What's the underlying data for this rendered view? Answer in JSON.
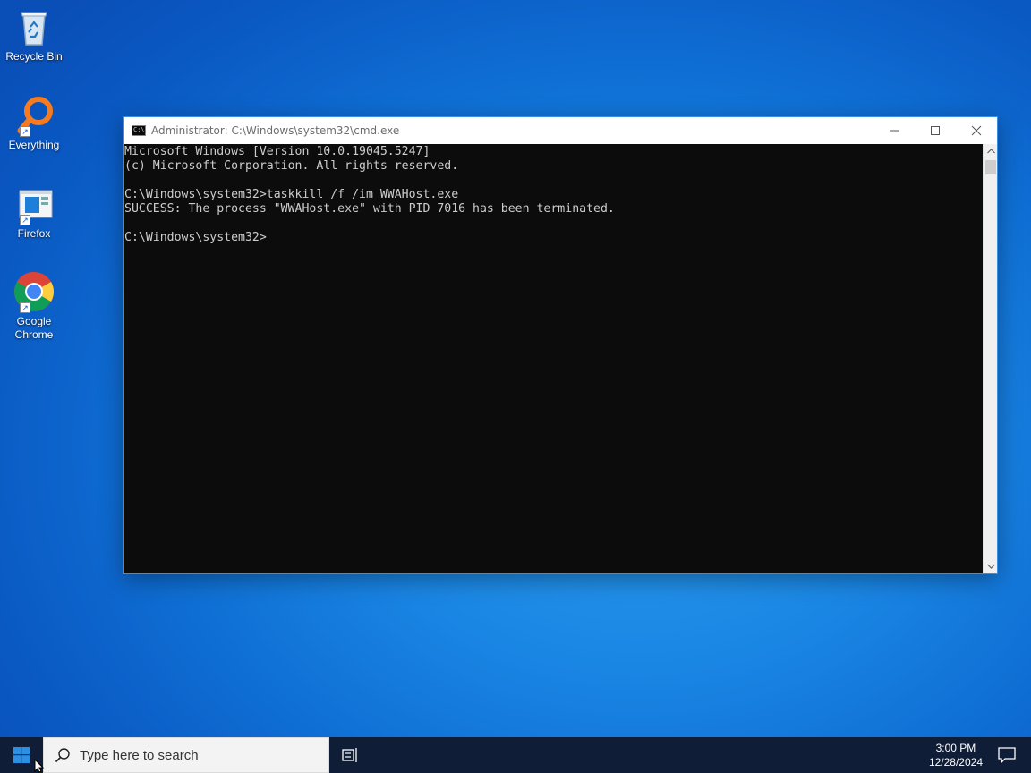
{
  "desktop": {
    "icons": [
      {
        "label": "Recycle Bin",
        "icon": "recycle-bin-icon"
      },
      {
        "label": "Everything",
        "icon": "everything-search-icon"
      },
      {
        "label": "Firefox",
        "icon": "firefox-icon"
      },
      {
        "label": "Google Chrome",
        "icon": "chrome-icon"
      }
    ]
  },
  "cmd": {
    "title": "Administrator: C:\\Windows\\system32\\cmd.exe",
    "lines": [
      "Microsoft Windows [Version 10.0.19045.5247]",
      "(c) Microsoft Corporation. All rights reserved.",
      "",
      "C:\\Windows\\system32>taskkill /f /im WWAHost.exe",
      "SUCCESS: The process \"WWAHost.exe\" with PID 7016 has been terminated.",
      "",
      "C:\\Windows\\system32>"
    ],
    "buttons": {
      "minimize": "—",
      "maximize": "☐",
      "close": "✕"
    }
  },
  "taskbar": {
    "search_placeholder": "Type here to search",
    "time": "3:00 PM",
    "date": "12/28/2024"
  },
  "colors": {
    "console_bg": "#0c0c0c",
    "console_fg": "#cccccc",
    "taskbar_bg": "#0f1d36",
    "accent": "#0078d7"
  }
}
